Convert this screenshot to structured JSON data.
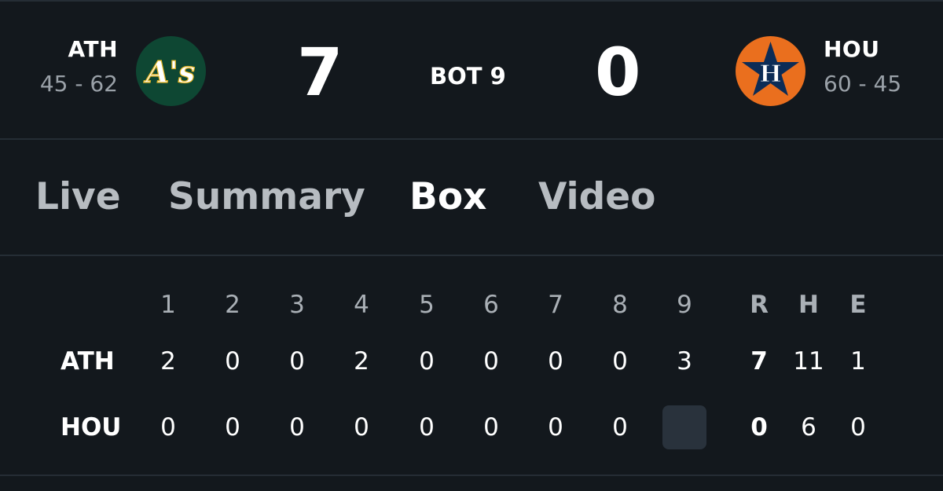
{
  "game": {
    "away": {
      "abbr": "ATH",
      "record": "45 - 62",
      "score": "7",
      "logo_icon": "athletics-logo-icon",
      "logo_color": "#0e4733"
    },
    "home": {
      "abbr": "HOU",
      "record": "60 - 45",
      "score": "0",
      "logo_icon": "astros-logo-icon",
      "logo_color": "#ea6f1e"
    },
    "status": "BOT 9"
  },
  "tabs": [
    {
      "label": "Live",
      "active": false
    },
    {
      "label": "Summary",
      "active": false
    },
    {
      "label": "Box",
      "active": true
    },
    {
      "label": "Video",
      "active": false
    }
  ],
  "linescore": {
    "innings": [
      "1",
      "2",
      "3",
      "4",
      "5",
      "6",
      "7",
      "8",
      "9"
    ],
    "totals_headers": [
      "R",
      "H",
      "E"
    ],
    "rows": [
      {
        "team": "ATH",
        "innings": [
          "2",
          "0",
          "0",
          "2",
          "0",
          "0",
          "0",
          "0",
          "3"
        ],
        "totals": [
          "7",
          "11",
          "1"
        ]
      },
      {
        "team": "HOU",
        "innings": [
          "0",
          "0",
          "0",
          "0",
          "0",
          "0",
          "0",
          "0",
          ""
        ],
        "totals": [
          "0",
          "6",
          "0"
        ]
      }
    ]
  },
  "logo_text": {
    "ath": "A's",
    "hou": "H"
  },
  "colors": {
    "background": "#13181d",
    "divider": "#252d35",
    "muted_text": "#9aa1a8",
    "inactive_tab": "#b7bcc1",
    "empty_inning_box": "#29323c"
  }
}
